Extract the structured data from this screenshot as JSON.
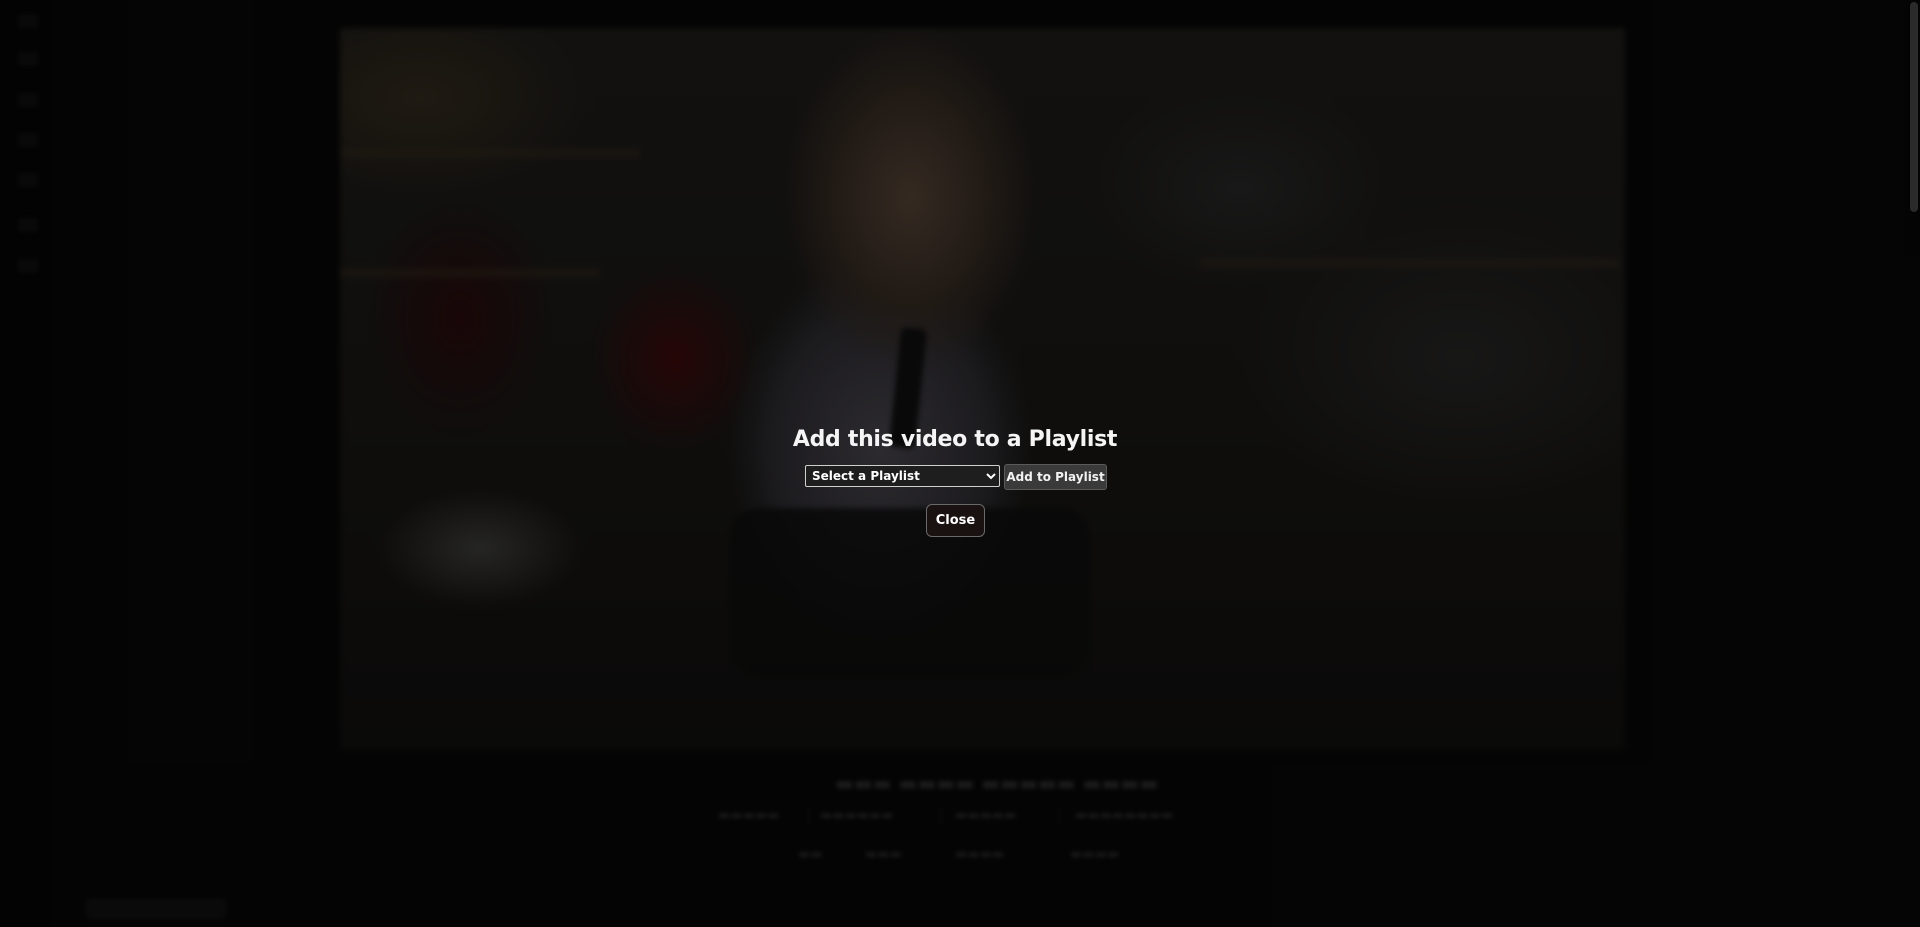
{
  "modal": {
    "heading": "Add this video to a Playlist",
    "playlist_select": {
      "selected": "Select a Playlist",
      "options": [
        "Select a Playlist"
      ]
    },
    "add_label": "Add to Playlist",
    "close_label": "Close"
  },
  "colors": {
    "overlay": "rgba(0,0,0,0.58)",
    "modal_text": "#f5f5f5",
    "add_button_bg": "#3a3a3a",
    "close_button_bg": "#1a1210"
  }
}
